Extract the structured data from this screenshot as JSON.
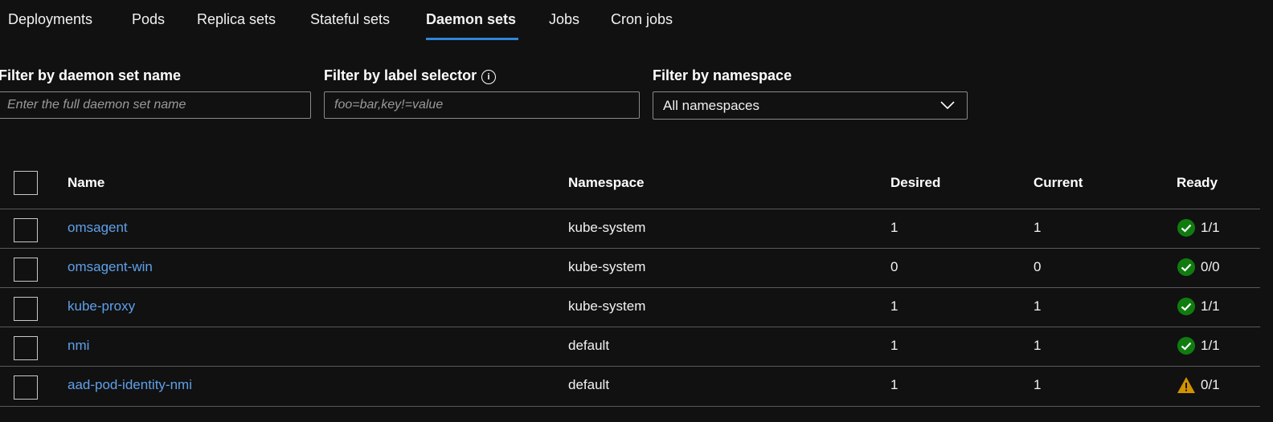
{
  "tabs": [
    {
      "label": "Deployments"
    },
    {
      "label": "Pods"
    },
    {
      "label": "Replica sets"
    },
    {
      "label": "Stateful sets"
    },
    {
      "label": "Daemon sets",
      "active": true
    },
    {
      "label": "Jobs"
    },
    {
      "label": "Cron jobs"
    }
  ],
  "filters": {
    "name": {
      "label": "Filter by daemon set name",
      "placeholder": "Enter the full daemon set name",
      "value": ""
    },
    "label_selector": {
      "label": "Filter by label selector",
      "placeholder": "foo=bar,key!=value",
      "value": ""
    },
    "namespace": {
      "label": "Filter by namespace",
      "value": "All namespaces"
    }
  },
  "table": {
    "columns": [
      "Name",
      "Namespace",
      "Desired",
      "Current",
      "Ready"
    ],
    "rows": [
      {
        "name": "omsagent",
        "namespace": "kube-system",
        "desired": "1",
        "current": "1",
        "ready": "1/1",
        "status": "success"
      },
      {
        "name": "omsagent-win",
        "namespace": "kube-system",
        "desired": "0",
        "current": "0",
        "ready": "0/0",
        "status": "success"
      },
      {
        "name": "kube-proxy",
        "namespace": "kube-system",
        "desired": "1",
        "current": "1",
        "ready": "1/1",
        "status": "success"
      },
      {
        "name": "nmi",
        "namespace": "default",
        "desired": "1",
        "current": "1",
        "ready": "1/1",
        "status": "success"
      },
      {
        "name": "aad-pod-identity-nmi",
        "namespace": "default",
        "desired": "1",
        "current": "1",
        "ready": "0/1",
        "status": "warning"
      }
    ]
  },
  "colors": {
    "accent": "#2f86d8",
    "link": "#5fa0ea",
    "success": "#107c10",
    "warning": "#d39300"
  }
}
